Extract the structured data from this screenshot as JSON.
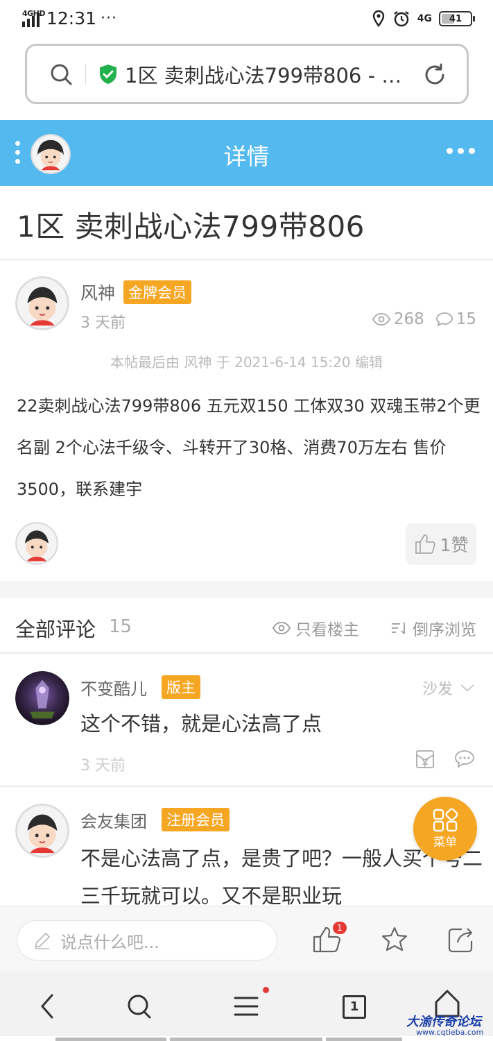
{
  "status_bar": {
    "network_label": "4GHD",
    "time": "12:31",
    "dots": "···",
    "network_right": "4G",
    "battery": "41"
  },
  "address_bar": {
    "url_title": "1区 卖刺战心法799带806 - …"
  },
  "header": {
    "title": "详情"
  },
  "post": {
    "title": "1区 卖刺战心法799带806",
    "author": {
      "name": "风神",
      "badge": "金牌会员",
      "time": "3 天前"
    },
    "views": "268",
    "comment_count": "15",
    "edit_note": "本帖最后由 风神 于 2021-6-14 15:20 编辑",
    "body": "22卖刺战心法799带806 五元双150 工体双30 双魂玉带2个更名副 2个心法千级令、斗转开了30格、消费70万左右 售价3500，联系建宇",
    "like_label": "1赞"
  },
  "comments": {
    "title": "全部评论",
    "count": "15",
    "owner_only": "只看楼主",
    "sort": "倒序浏览",
    "items": [
      {
        "name": "不变酷儿",
        "badge": "版主",
        "floor": "沙发",
        "text": "这个不错，就是心法高了点",
        "time": "3 天前"
      },
      {
        "name": "会友集团",
        "badge": "注册会员",
        "text": "不是心法高了点，是贵了吧？一般人买个号二三千玩就可以。又不是职业玩"
      }
    ]
  },
  "menu_fab": {
    "label": "菜单"
  },
  "input_bar": {
    "placeholder": "说点什么吧...",
    "like_badge": "1"
  },
  "nav_bar": {
    "tab_count": "1"
  },
  "watermark": {
    "title": "大渝传奇论坛",
    "url": "www.cqtieba.com"
  },
  "colors": {
    "header_blue": "#53b9ef",
    "badge_orange": "#f5a623",
    "shield_green": "#22b14c"
  }
}
